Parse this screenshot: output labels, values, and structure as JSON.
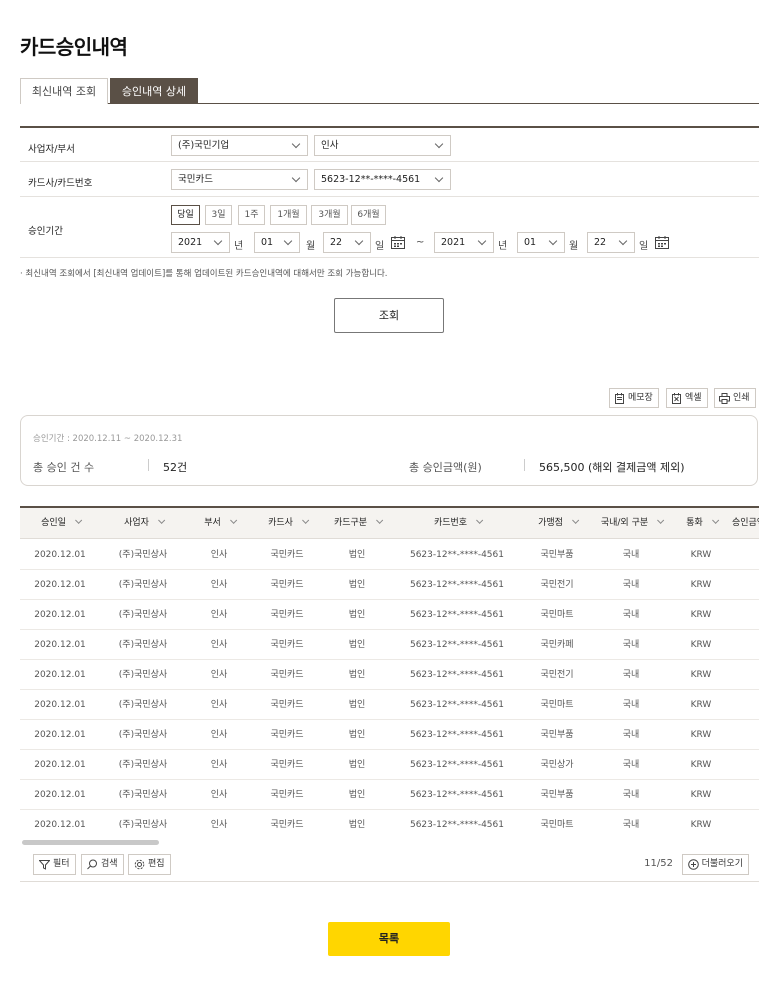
{
  "page_title": "카드승인내역",
  "tabs": [
    "최신내역 조회",
    "승인내역 상세"
  ],
  "form": {
    "biz_label": "사업자/부서",
    "biz_value": "(주)국민기업",
    "dept_value": "인사",
    "card_label": "카드사/카드번호",
    "card_company": "국민카드",
    "card_number": "5623-12**-****-4561",
    "period_label": "승인기간",
    "period_buttons": [
      "당일",
      "3일",
      "1주",
      "1개월",
      "3개월",
      "6개월"
    ],
    "start": {
      "year": "2021",
      "month": "01",
      "day": "22"
    },
    "end": {
      "year": "2021",
      "month": "01",
      "day": "22"
    },
    "unit_year": "년",
    "unit_month": "월",
    "unit_day": "일",
    "tilde": "~"
  },
  "note": "· 최신내역 조회에서 [최신내역 업데이트]를 통해 업데이트된 카드승인내역에 대해서만 조회 가능합니다.",
  "inquiry_button": "조회",
  "tools": [
    "메모장",
    "엑셀",
    "인쇄"
  ],
  "summary": {
    "period": "승인기간 : 2020.12.11 ~ 2020.12.31",
    "count_label": "총 승인 건 수",
    "count_value": "52건",
    "amount_label": "총 승인금액(원)",
    "amount_value": "565,500 (해외 결제금액 제외)"
  },
  "table": {
    "headers": [
      "승인일",
      "사업자",
      "부서",
      "카드사",
      "카드구분",
      "카드번호",
      "가맹점",
      "국내/외 구분",
      "통화",
      "승인금액"
    ],
    "rows": [
      [
        "2020.12.01",
        "(주)국민상사",
        "인사",
        "국민카드",
        "법인",
        "5623-12**-****-4561",
        "국민부품",
        "국내",
        "KRW"
      ],
      [
        "2020.12.01",
        "(주)국민상사",
        "인사",
        "국민카드",
        "법인",
        "5623-12**-****-4561",
        "국민전기",
        "국내",
        "KRW"
      ],
      [
        "2020.12.01",
        "(주)국민상사",
        "인사",
        "국민카드",
        "법인",
        "5623-12**-****-4561",
        "국민마트",
        "국내",
        "KRW"
      ],
      [
        "2020.12.01",
        "(주)국민상사",
        "인사",
        "국민카드",
        "법인",
        "5623-12**-****-4561",
        "국민카페",
        "국내",
        "KRW"
      ],
      [
        "2020.12.01",
        "(주)국민상사",
        "인사",
        "국민카드",
        "법인",
        "5623-12**-****-4561",
        "국민전기",
        "국내",
        "KRW"
      ],
      [
        "2020.12.01",
        "(주)국민상사",
        "인사",
        "국민카드",
        "법인",
        "5623-12**-****-4561",
        "국민마트",
        "국내",
        "KRW"
      ],
      [
        "2020.12.01",
        "(주)국민상사",
        "인사",
        "국민카드",
        "법인",
        "5623-12**-****-4561",
        "국민부품",
        "국내",
        "KRW"
      ],
      [
        "2020.12.01",
        "(주)국민상사",
        "인사",
        "국민카드",
        "법인",
        "5623-12**-****-4561",
        "국민상가",
        "국내",
        "KRW"
      ],
      [
        "2020.12.01",
        "(주)국민상사",
        "인사",
        "국민카드",
        "법인",
        "5623-12**-****-4561",
        "국민부품",
        "국내",
        "KRW"
      ],
      [
        "2020.12.01",
        "(주)국민상사",
        "인사",
        "국민카드",
        "법인",
        "5623-12**-****-4561",
        "국민마트",
        "국내",
        "KRW"
      ]
    ]
  },
  "bottom_tools": [
    "필터",
    "검색",
    "편집"
  ],
  "pager": "11/52",
  "load_more": "더불러오기",
  "list_button": "목록",
  "colors": {
    "accent": "#5a5046",
    "list_button": "#ffd600"
  }
}
